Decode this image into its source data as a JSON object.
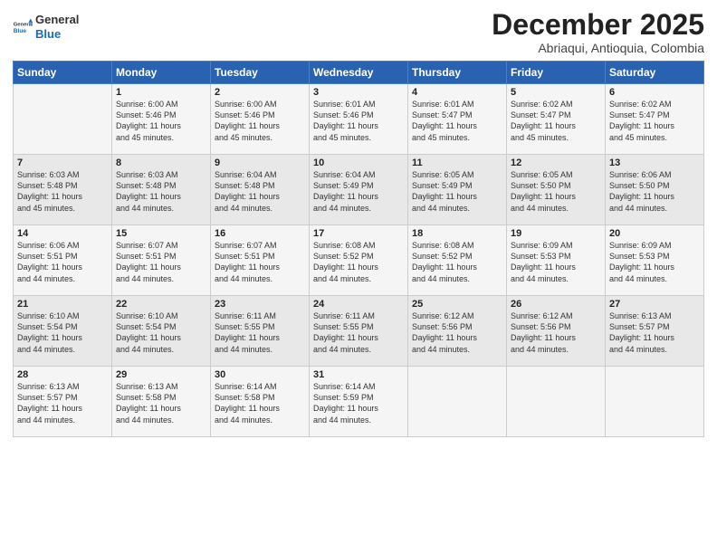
{
  "header": {
    "logo_general": "General",
    "logo_blue": "Blue",
    "month_title": "December 2025",
    "location": "Abriaqui, Antioquia, Colombia"
  },
  "days_of_week": [
    "Sunday",
    "Monday",
    "Tuesday",
    "Wednesday",
    "Thursday",
    "Friday",
    "Saturday"
  ],
  "weeks": [
    [
      {
        "day": "",
        "sunrise": "",
        "sunset": "",
        "daylight": ""
      },
      {
        "day": "1",
        "sunrise": "Sunrise: 6:00 AM",
        "sunset": "Sunset: 5:46 PM",
        "daylight": "Daylight: 11 hours and 45 minutes."
      },
      {
        "day": "2",
        "sunrise": "Sunrise: 6:00 AM",
        "sunset": "Sunset: 5:46 PM",
        "daylight": "Daylight: 11 hours and 45 minutes."
      },
      {
        "day": "3",
        "sunrise": "Sunrise: 6:01 AM",
        "sunset": "Sunset: 5:46 PM",
        "daylight": "Daylight: 11 hours and 45 minutes."
      },
      {
        "day": "4",
        "sunrise": "Sunrise: 6:01 AM",
        "sunset": "Sunset: 5:47 PM",
        "daylight": "Daylight: 11 hours and 45 minutes."
      },
      {
        "day": "5",
        "sunrise": "Sunrise: 6:02 AM",
        "sunset": "Sunset: 5:47 PM",
        "daylight": "Daylight: 11 hours and 45 minutes."
      },
      {
        "day": "6",
        "sunrise": "Sunrise: 6:02 AM",
        "sunset": "Sunset: 5:47 PM",
        "daylight": "Daylight: 11 hours and 45 minutes."
      }
    ],
    [
      {
        "day": "7",
        "sunrise": "Sunrise: 6:03 AM",
        "sunset": "Sunset: 5:48 PM",
        "daylight": "Daylight: 11 hours and 45 minutes."
      },
      {
        "day": "8",
        "sunrise": "Sunrise: 6:03 AM",
        "sunset": "Sunset: 5:48 PM",
        "daylight": "Daylight: 11 hours and 44 minutes."
      },
      {
        "day": "9",
        "sunrise": "Sunrise: 6:04 AM",
        "sunset": "Sunset: 5:48 PM",
        "daylight": "Daylight: 11 hours and 44 minutes."
      },
      {
        "day": "10",
        "sunrise": "Sunrise: 6:04 AM",
        "sunset": "Sunset: 5:49 PM",
        "daylight": "Daylight: 11 hours and 44 minutes."
      },
      {
        "day": "11",
        "sunrise": "Sunrise: 6:05 AM",
        "sunset": "Sunset: 5:49 PM",
        "daylight": "Daylight: 11 hours and 44 minutes."
      },
      {
        "day": "12",
        "sunrise": "Sunrise: 6:05 AM",
        "sunset": "Sunset: 5:50 PM",
        "daylight": "Daylight: 11 hours and 44 minutes."
      },
      {
        "day": "13",
        "sunrise": "Sunrise: 6:06 AM",
        "sunset": "Sunset: 5:50 PM",
        "daylight": "Daylight: 11 hours and 44 minutes."
      }
    ],
    [
      {
        "day": "14",
        "sunrise": "Sunrise: 6:06 AM",
        "sunset": "Sunset: 5:51 PM",
        "daylight": "Daylight: 11 hours and 44 minutes."
      },
      {
        "day": "15",
        "sunrise": "Sunrise: 6:07 AM",
        "sunset": "Sunset: 5:51 PM",
        "daylight": "Daylight: 11 hours and 44 minutes."
      },
      {
        "day": "16",
        "sunrise": "Sunrise: 6:07 AM",
        "sunset": "Sunset: 5:51 PM",
        "daylight": "Daylight: 11 hours and 44 minutes."
      },
      {
        "day": "17",
        "sunrise": "Sunrise: 6:08 AM",
        "sunset": "Sunset: 5:52 PM",
        "daylight": "Daylight: 11 hours and 44 minutes."
      },
      {
        "day": "18",
        "sunrise": "Sunrise: 6:08 AM",
        "sunset": "Sunset: 5:52 PM",
        "daylight": "Daylight: 11 hours and 44 minutes."
      },
      {
        "day": "19",
        "sunrise": "Sunrise: 6:09 AM",
        "sunset": "Sunset: 5:53 PM",
        "daylight": "Daylight: 11 hours and 44 minutes."
      },
      {
        "day": "20",
        "sunrise": "Sunrise: 6:09 AM",
        "sunset": "Sunset: 5:53 PM",
        "daylight": "Daylight: 11 hours and 44 minutes."
      }
    ],
    [
      {
        "day": "21",
        "sunrise": "Sunrise: 6:10 AM",
        "sunset": "Sunset: 5:54 PM",
        "daylight": "Daylight: 11 hours and 44 minutes."
      },
      {
        "day": "22",
        "sunrise": "Sunrise: 6:10 AM",
        "sunset": "Sunset: 5:54 PM",
        "daylight": "Daylight: 11 hours and 44 minutes."
      },
      {
        "day": "23",
        "sunrise": "Sunrise: 6:11 AM",
        "sunset": "Sunset: 5:55 PM",
        "daylight": "Daylight: 11 hours and 44 minutes."
      },
      {
        "day": "24",
        "sunrise": "Sunrise: 6:11 AM",
        "sunset": "Sunset: 5:55 PM",
        "daylight": "Daylight: 11 hours and 44 minutes."
      },
      {
        "day": "25",
        "sunrise": "Sunrise: 6:12 AM",
        "sunset": "Sunset: 5:56 PM",
        "daylight": "Daylight: 11 hours and 44 minutes."
      },
      {
        "day": "26",
        "sunrise": "Sunrise: 6:12 AM",
        "sunset": "Sunset: 5:56 PM",
        "daylight": "Daylight: 11 hours and 44 minutes."
      },
      {
        "day": "27",
        "sunrise": "Sunrise: 6:13 AM",
        "sunset": "Sunset: 5:57 PM",
        "daylight": "Daylight: 11 hours and 44 minutes."
      }
    ],
    [
      {
        "day": "28",
        "sunrise": "Sunrise: 6:13 AM",
        "sunset": "Sunset: 5:57 PM",
        "daylight": "Daylight: 11 hours and 44 minutes."
      },
      {
        "day": "29",
        "sunrise": "Sunrise: 6:13 AM",
        "sunset": "Sunset: 5:58 PM",
        "daylight": "Daylight: 11 hours and 44 minutes."
      },
      {
        "day": "30",
        "sunrise": "Sunrise: 6:14 AM",
        "sunset": "Sunset: 5:58 PM",
        "daylight": "Daylight: 11 hours and 44 minutes."
      },
      {
        "day": "31",
        "sunrise": "Sunrise: 6:14 AM",
        "sunset": "Sunset: 5:59 PM",
        "daylight": "Daylight: 11 hours and 44 minutes."
      },
      {
        "day": "",
        "sunrise": "",
        "sunset": "",
        "daylight": ""
      },
      {
        "day": "",
        "sunrise": "",
        "sunset": "",
        "daylight": ""
      },
      {
        "day": "",
        "sunrise": "",
        "sunset": "",
        "daylight": ""
      }
    ]
  ]
}
